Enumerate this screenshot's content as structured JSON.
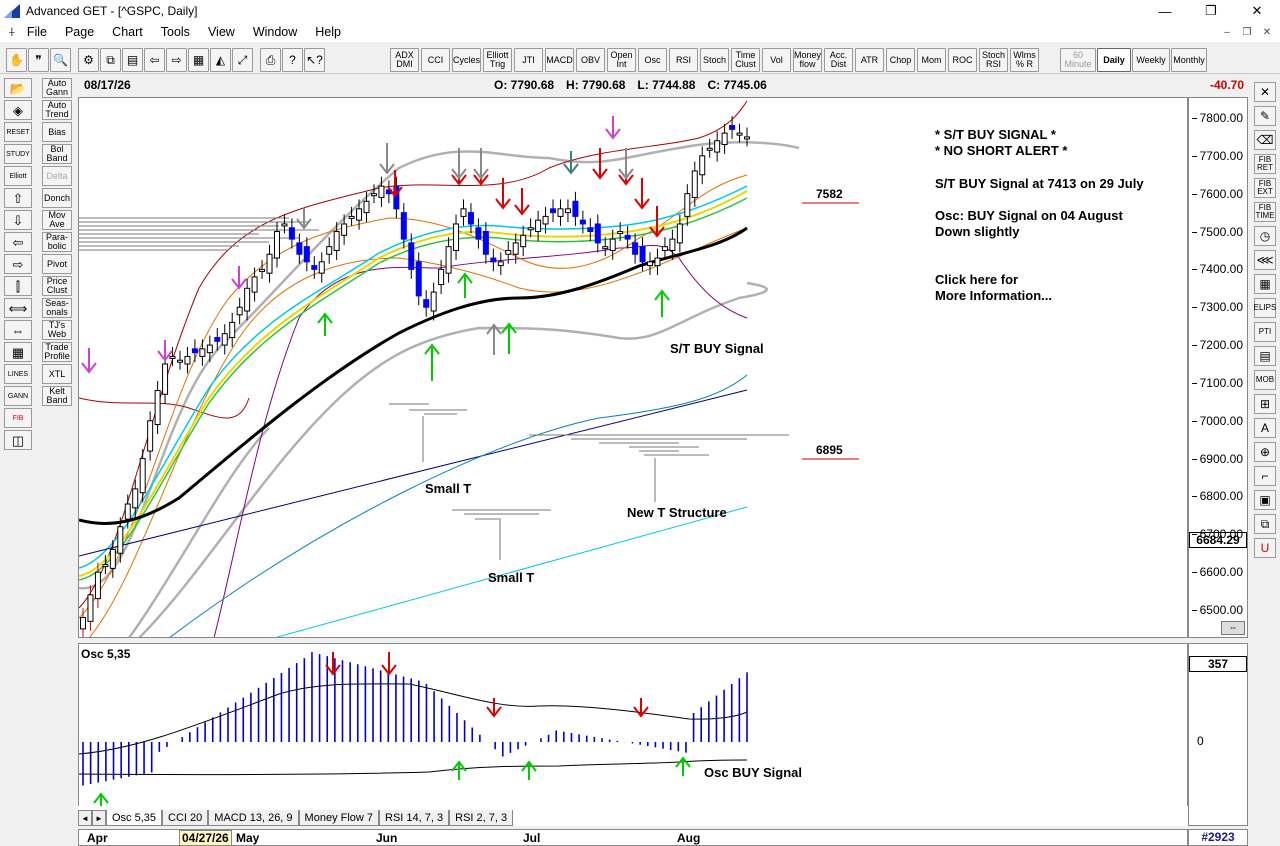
{
  "window": {
    "title": "Advanced GET - [^GSPC, Daily]",
    "controls": {
      "minimize": "—",
      "maximize": "❐",
      "close": "✕"
    }
  },
  "menu": {
    "items": [
      "File",
      "Page",
      "Chart",
      "Tools",
      "View",
      "Window",
      "Help"
    ],
    "mdi": {
      "minimize": "–",
      "restore": "❐",
      "close": "✕"
    }
  },
  "toolbar": {
    "icons": [
      "hand-icon",
      "quote-icon",
      "magnifier-icon",
      "gear-icon",
      "copy-icon",
      "page-icon",
      "left-arrow-icon",
      "right-arrow-icon",
      "chart-icon",
      "mountain-icon",
      "expand-icon",
      "print-icon",
      "help-icon",
      "whats-this-icon"
    ],
    "study_buttons": [
      "ADX\nDMI",
      "CCI",
      "Cycles",
      "Elliott\nTrig",
      "JTI",
      "MACD",
      "OBV",
      "Open\nInt",
      "Osc",
      "RSI",
      "Stoch",
      "Time\nClust",
      "Vol",
      "Money\nflow",
      "Acc.\nDist",
      "ATR",
      "Chop",
      "Mom",
      "ROC",
      "Stoch\nRSI",
      "Wlms\n% R"
    ],
    "timeframes": [
      "60\nMinute",
      "Daily",
      "Weekly",
      "Monthly"
    ],
    "active_timeframe": "Daily"
  },
  "left_tools": [
    {
      "label": "Auto\nGann"
    },
    {
      "label": "Auto\nTrend"
    },
    {
      "label": "Bias"
    },
    {
      "label": "Bol\nBand"
    },
    {
      "label": "Delta"
    },
    {
      "label": "Donch"
    },
    {
      "label": "Mov\nAve"
    },
    {
      "label": "Para-\nbolic"
    },
    {
      "label": "Pivot"
    },
    {
      "label": "Price\nClust"
    },
    {
      "label": "Seas-\nonals"
    },
    {
      "label": "TJ's\nWeb"
    },
    {
      "label": "Trade\nProfile"
    },
    {
      "label": "XTL"
    },
    {
      "label": "Kelt\nBand"
    }
  ],
  "left_icons": [
    "RESET",
    "STUDY",
    "Elliott",
    "LINES",
    "GANN",
    "FIB"
  ],
  "right_tools": [
    "FIB\nRET",
    "FIB\nEXT",
    "FIB\nTIME",
    "ELIPS",
    "PTI",
    "MOB"
  ],
  "price_bar": {
    "date": "08/17/26",
    "open": "O: 7790.68",
    "high": "H: 7790.68",
    "low": "L: 7744.88",
    "close": "C: 7745.06",
    "change": "-40.70"
  },
  "axis": {
    "ticks": [
      "7800.00",
      "7700.00",
      "7600.00",
      "7500.00",
      "7400.00",
      "7300.00",
      "7200.00",
      "7100.00",
      "7000.00",
      "6900.00",
      "6800.00",
      "6700.00",
      "6600.00",
      "6500.00"
    ],
    "last_price": "6684.29",
    "magnify_label": "⇔"
  },
  "annotations": {
    "signal_title_1": "* S/T BUY SIGNAL *",
    "signal_title_2": "* NO SHORT ALERT *",
    "st_buy_detail": "S/T BUY Signal at 7413 on 29 July",
    "osc_detail_1": "Osc: BUY Signal on 04 August",
    "osc_detail_2": "Down slightly",
    "click_1": "Click here for",
    "click_2": "More Information...",
    "level_upper": "7582",
    "level_lower": "6895",
    "st_buy_label": "S/T BUY Signal",
    "small_t_1": "Small T",
    "small_t_2": "Small T",
    "new_t": "New T Structure"
  },
  "osc": {
    "title": "Osc 5,35",
    "value": "357",
    "zero": "0",
    "buy_label": "Osc BUY Signal",
    "tabs": [
      "Osc 5,35",
      "CCI 20",
      "MACD 13, 26, 9",
      "Money Flow 7",
      "RSI 14, 7, 3",
      "RSI 2, 7, 3"
    ],
    "nav_prev": "◄",
    "nav_next": "►"
  },
  "date_axis": {
    "labels": [
      "Apr",
      "May",
      "Jun",
      "Jul",
      "Aug"
    ],
    "current_date": "04/27/26",
    "bar_count": "#2923"
  },
  "colors": {
    "buy_arrow": "#00cc00",
    "sell_arrow": "#dd0000",
    "neutral_arrow": "#888888",
    "candle_up": "#ffffff",
    "candle_down": "#0000ff",
    "ma_black": "#000000",
    "channel_red": "#aa0000",
    "channel_orange": "#e07000",
    "band_cyan": "#00c8e8",
    "band_yellow": "#e8d800",
    "band_green": "#30c040",
    "band_purple": "#800080",
    "band_gray": "#b0b0b0",
    "trend_blue": "#000080",
    "trend_teal": "#0080c0",
    "osc_bar": "#0000cc"
  }
}
